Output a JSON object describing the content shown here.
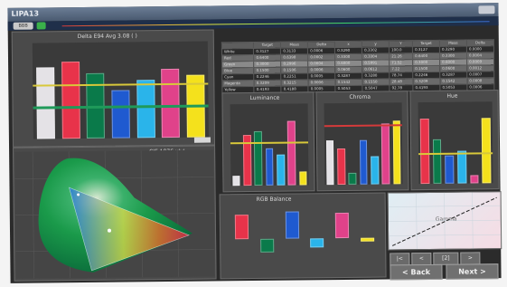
{
  "app": {
    "title": "LIPA13",
    "brand_color": "#4a5a70"
  },
  "colors": {
    "white": "#e4e2e6",
    "red": "#e8334a",
    "green": "#0a7a4a",
    "blue": "#1f5ad0",
    "cyan": "#2ab4ea",
    "magenta": "#e0428a",
    "yellow": "#f4e11c",
    "reference_line": "#e2d23a",
    "avg_line": "#1f9a5a",
    "panel_bg": "#4a4a4a"
  },
  "toolbar": {
    "menu_label": "BBB"
  },
  "panels": {
    "delta_e": {
      "title": "Delta E94 Avg 3.08 ( )"
    },
    "luminance": {
      "title": "Luminance"
    },
    "chroma": {
      "title": "Chroma"
    },
    "hue": {
      "title": "Hue"
    },
    "gamut": {
      "title": "CIE 1976 u'v'"
    },
    "rgb_balance": {
      "title": "RGB Balance"
    },
    "gamma": {
      "title": "Gamma"
    }
  },
  "table": {
    "headers": [
      "",
      "Target",
      "Meas",
      "Delta",
      "x",
      "y",
      "Y",
      "Target",
      "Meas",
      "Delta"
    ],
    "rows": [
      [
        "White",
        "0.3127",
        "0.3133",
        "0.0006",
        "0.3290",
        "0.3302",
        "100.0",
        "0.3127",
        "0.3290",
        "0.0000"
      ],
      [
        "Red",
        "0.6400",
        "0.6398",
        "0.0002",
        "0.3300",
        "0.3304",
        "21.26",
        "0.6400",
        "0.3300",
        "0.0004"
      ],
      [
        "Green",
        "0.3000",
        "0.2996",
        "0.0004",
        "0.6000",
        "0.5991",
        "71.52",
        "0.3000",
        "0.6000",
        "0.0009"
      ],
      [
        "Blue",
        "0.1500",
        "0.1506",
        "0.0006",
        "0.0600",
        "0.0612",
        "7.22",
        "0.1500",
        "0.0600",
        "0.0012"
      ],
      [
        "Cyan",
        "0.2246",
        "0.2251",
        "0.0005",
        "0.3287",
        "0.3280",
        "78.74",
        "0.2246",
        "0.3287",
        "0.0007"
      ],
      [
        "Magenta",
        "0.3209",
        "0.3215",
        "0.0006",
        "0.1542",
        "0.1550",
        "28.48",
        "0.3209",
        "0.1542",
        "0.0008"
      ],
      [
        "Yellow",
        "0.4193",
        "0.4188",
        "0.0005",
        "0.5053",
        "0.5047",
        "92.78",
        "0.4193",
        "0.5053",
        "0.0006"
      ]
    ]
  },
  "buttons": {
    "nav_first": "|<",
    "nav_prev": "<",
    "nav_page": "[2]",
    "nav_next": ">",
    "back": "< Back",
    "next": "Next >"
  },
  "chart_data": [
    {
      "type": "bar",
      "title": "Delta E94 Avg 3.08",
      "categories": [
        "White",
        "Red",
        "Green",
        "Blue",
        "Cyan",
        "Magenta",
        "Yellow"
      ],
      "values": [
        7.5,
        8.0,
        6.8,
        5.0,
        6.0,
        7.2,
        6.5
      ],
      "ylim": [
        0,
        10
      ]
    },
    {
      "type": "bar",
      "title": "Luminance",
      "categories": [
        "White",
        "Red",
        "Green",
        "Blue",
        "Cyan",
        "Magenta",
        "Yellow"
      ],
      "values": [
        1.5,
        7.5,
        8.0,
        5.5,
        4.5,
        9.5,
        2.0
      ],
      "ylim": [
        0,
        12
      ]
    },
    {
      "type": "bar",
      "title": "Chroma",
      "categories": [
        "White",
        "Red",
        "Green",
        "Blue",
        "Cyan",
        "Magenta",
        "Yellow"
      ],
      "values": [
        5.5,
        4.5,
        1.5,
        5.5,
        3.5,
        7.5,
        7.8
      ],
      "ylim": [
        0,
        10
      ]
    },
    {
      "type": "bar",
      "title": "Hue",
      "categories": [
        "Red",
        "Green",
        "Blue",
        "Cyan",
        "Magenta",
        "Yellow"
      ],
      "values": [
        8.0,
        5.5,
        3.5,
        4.0,
        1.0,
        8.0
      ],
      "ylim": [
        0,
        10
      ]
    },
    {
      "type": "bar",
      "title": "RGB Balance",
      "categories": [
        "Red",
        "Green",
        "Blue",
        "Cyan",
        "Magenta",
        "Yellow"
      ],
      "values": [
        2.2,
        -1.2,
        2.4,
        -0.8,
        2.3,
        -0.3
      ],
      "ylim": [
        -3,
        3
      ]
    }
  ]
}
